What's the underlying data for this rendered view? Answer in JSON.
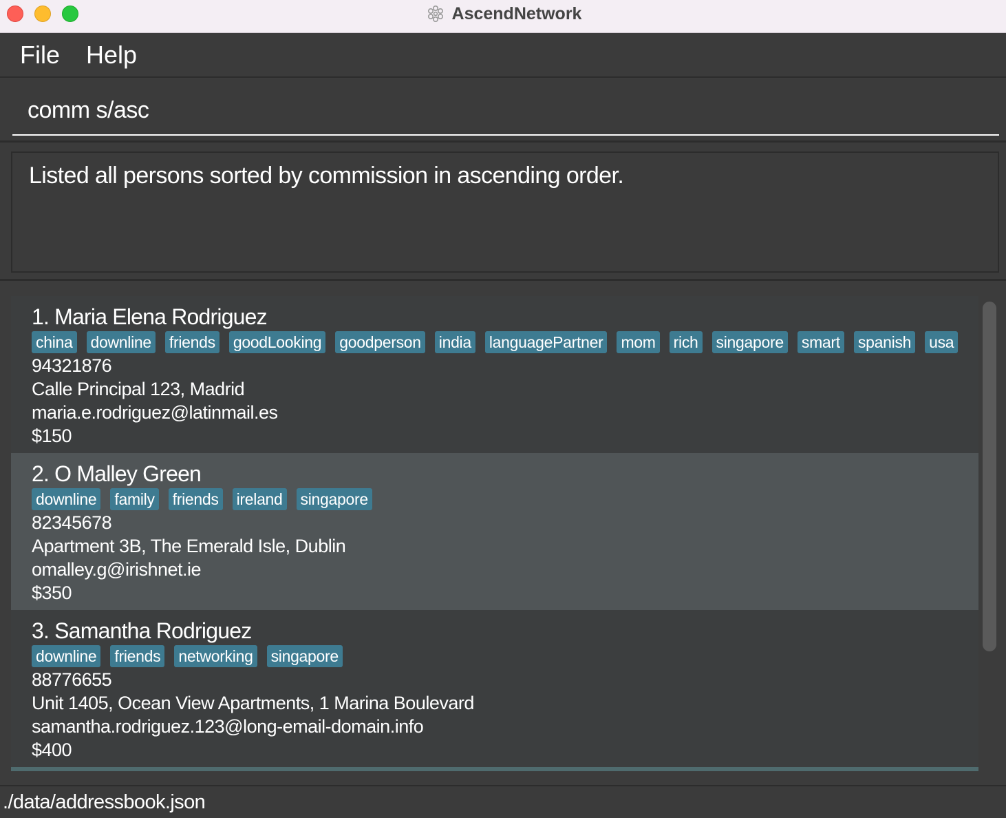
{
  "window": {
    "title": "AscendNetwork",
    "controls": [
      "close",
      "minimize",
      "maximize"
    ]
  },
  "menu": {
    "items": [
      {
        "label": "File"
      },
      {
        "label": "Help"
      }
    ]
  },
  "command": {
    "value": "comm s/asc"
  },
  "result": {
    "message": "Listed all persons sorted by commission in ascending order."
  },
  "persons": [
    {
      "name": "1. Maria Elena Rodriguez",
      "tags": [
        "china",
        "downline",
        "friends",
        "goodLooking",
        "goodperson",
        "india",
        "languagePartner",
        "mom",
        "rich",
        "singapore",
        "smart",
        "spanish",
        "usa"
      ],
      "phone": "94321876",
      "address": "Calle Principal 123, Madrid",
      "email": "maria.e.rodriguez@latinmail.es",
      "commission": "$150"
    },
    {
      "name": "2. O Malley Green",
      "tags": [
        "downline",
        "family",
        "friends",
        "ireland",
        "singapore"
      ],
      "phone": "82345678",
      "address": "Apartment 3B, The Emerald Isle, Dublin",
      "email": "omalley.g@irishnet.ie",
      "commission": "$350"
    },
    {
      "name": "3. Samantha Rodriguez",
      "tags": [
        "downline",
        "friends",
        "networking",
        "singapore"
      ],
      "phone": "88776655",
      "address": "Unit 1405, Ocean View Apartments, 1 Marina Boulevard",
      "email": "samantha.rodriguez.123@long-email-domain.info",
      "commission": "$400"
    }
  ],
  "status": {
    "path": "./data/addressbook.json"
  },
  "colors": {
    "background": "#3c3c3c",
    "tag": "#3e7b91",
    "selected_row": "#505557",
    "titlebar": "#f4eef4"
  }
}
